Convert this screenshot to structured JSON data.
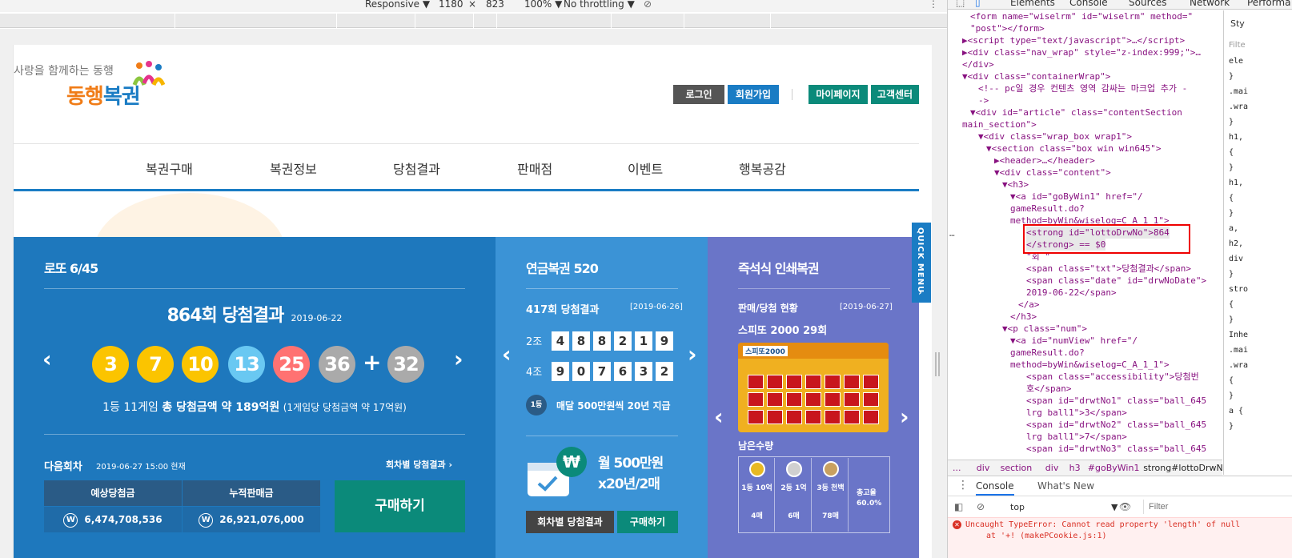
{
  "device_toolbar": {
    "mode": "Responsive ▼",
    "width": "1180",
    "times": "×",
    "height": "823",
    "zoom": "100% ▼",
    "throttle": "No throttling ▼"
  },
  "header": {
    "brand_sub": "사랑을 함께하는 동행",
    "brand_main_a": "동행",
    "brand_main_b": "복권",
    "login": "로그인",
    "join": "회원가입",
    "mypage": "마이페이지",
    "support": "고객센터"
  },
  "gnb": [
    "복권구매",
    "복권정보",
    "당첨결과",
    "판매점",
    "이벤트",
    "행복공감"
  ],
  "lotto": {
    "title": "로또 6/45",
    "round_result": "864회 당첨결과",
    "date": "2019-06-22",
    "balls": [
      {
        "n": "3",
        "color": "#fbc400"
      },
      {
        "n": "7",
        "color": "#fbc400"
      },
      {
        "n": "10",
        "color": "#fbc400"
      },
      {
        "n": "13",
        "color": "#69c8f2"
      },
      {
        "n": "25",
        "color": "#ff7272"
      },
      {
        "n": "36",
        "color": "#aaaaaa"
      }
    ],
    "plus": "+",
    "bonus": {
      "n": "32",
      "color": "#aaaaaa"
    },
    "prize_line_a": "1등 11게임",
    "prize_line_b": "총 당첨금액 약 189억원",
    "prize_line_c": "(1게임당 당첨금액 약 17억원)",
    "next_label": "다음회차",
    "next_date": "2019-06-27 15:00 현재",
    "by_round": "회차별 당첨결과",
    "expected_label": "예상당첨금",
    "accum_label": "누적판매금",
    "expected_value": "6,474,708,536",
    "accum_value": "26,921,076,000",
    "won_symbol": "W",
    "buy": "구매하기"
  },
  "pension": {
    "title": "연금복권 520",
    "round_result": "417회 당첨결과",
    "date": "[2019-06-26]",
    "row1_label": "2조",
    "row1": [
      "4",
      "8",
      "8",
      "2",
      "1",
      "9"
    ],
    "row2_label": "4조",
    "row2": [
      "9",
      "0",
      "7",
      "6",
      "3",
      "2"
    ],
    "first_badge": "1등",
    "first_desc": "매달 500만원씩 20년 지급",
    "promo_won": "₩",
    "promo_a": "월 500만원",
    "promo_b": "x20년/2매",
    "btn_round": "회차별 당첨결과",
    "btn_buy": "구매하기"
  },
  "instant": {
    "title": "즉석식 인쇄복권",
    "status": "판매/당첨 현황",
    "date": "[2019-06-27]",
    "game": "스피또 2000 29회",
    "ticket_label": "스피또2000",
    "remain": "남은수량",
    "cols": [
      "1등 10억",
      "2등 1억",
      "3등 천백"
    ],
    "counts": [
      "4매",
      "6매",
      "78매"
    ],
    "rate_label": "총고율",
    "rate_value": "60.0%"
  },
  "quickmenu": "QUICK MENU",
  "devtools": {
    "tabs": [
      "Elements",
      "Console",
      "Sources",
      "Network",
      "Performa"
    ],
    "lines": [
      {
        "indent": 2,
        "html": "&lt;form name=\"wiselrm\" id=\"wiselrm\" method=\""
      },
      {
        "indent": 2,
        "html": "\"post\"&gt;&lt;/form&gt;"
      },
      {
        "indent": 1,
        "html": "▶&lt;script type=\"text/javascript\"&gt;…&lt;/script&gt;"
      },
      {
        "indent": 1,
        "html": "▶&lt;div class=\"nav_wrap\" style=\"z-index:999;\"&gt;…"
      },
      {
        "indent": 1,
        "html": "&lt;/div&gt;"
      },
      {
        "indent": 1,
        "html": "▼&lt;div class=\"containerWrap\"&gt;"
      },
      {
        "indent": 3,
        "html": "&lt;!-- pc일 경우 컨텐츠 영역 감싸는 마크업 추가 -"
      },
      {
        "indent": 3,
        "html": "-&gt;"
      },
      {
        "indent": 2,
        "html": "▼&lt;div id=\"article\" class=\"contentSection"
      },
      {
        "indent": 1,
        "html": "main_section\"&gt;"
      },
      {
        "indent": 3,
        "html": "▼&lt;div class=\"wrap_box wrap1\"&gt;"
      },
      {
        "indent": 4,
        "html": "▼&lt;section class=\"box win win645\"&gt;"
      },
      {
        "indent": 5,
        "html": "▶&lt;header&gt;…&lt;/header&gt;"
      },
      {
        "indent": 5,
        "html": "▼&lt;div class=\"content\"&gt;"
      },
      {
        "indent": 6,
        "html": "▼&lt;h3&gt;"
      },
      {
        "indent": 7,
        "html": "▼&lt;a id=\"goByWin1\" href=\"/"
      },
      {
        "indent": 7,
        "html": "gameResult.do?"
      },
      {
        "indent": 7,
        "html": "method=byWin&amp;wiselog=C_A_1_1\"&gt;"
      },
      {
        "indent": 9,
        "html": "&lt;strong id=\"lottoDrwNo\"&gt;864"
      },
      {
        "indent": 9,
        "html": "&lt;/strong&gt; == $0"
      },
      {
        "indent": 9,
        "html": "\"회 \""
      },
      {
        "indent": 9,
        "html": "&lt;span class=\"txt\"&gt;당첨결과&lt;/span&gt;"
      },
      {
        "indent": 9,
        "html": "&lt;span class=\"date\" id=\"drwNoDate\"&gt;"
      },
      {
        "indent": 9,
        "html": "2019-06-22&lt;/span&gt;"
      },
      {
        "indent": 8,
        "html": "&lt;/a&gt;"
      },
      {
        "indent": 7,
        "html": "&lt;/h3&gt;"
      },
      {
        "indent": 6,
        "html": "▼&lt;p class=\"num\"&gt;"
      },
      {
        "indent": 7,
        "html": "▼&lt;a id=\"numView\" href=\"/"
      },
      {
        "indent": 7,
        "html": "gameResult.do?"
      },
      {
        "indent": 7,
        "html": "method=byWin&amp;wiselog=C_A_1_1\"&gt;"
      },
      {
        "indent": 9,
        "html": "&lt;span class=\"accessibility\"&gt;당첨번"
      },
      {
        "indent": 9,
        "html": "호&lt;/span&gt;"
      },
      {
        "indent": 9,
        "html": "&lt;span id=\"drwtNo1\" class=\"ball_645"
      },
      {
        "indent": 9,
        "html": "lrg ball1\"&gt;3&lt;/span&gt;"
      },
      {
        "indent": 9,
        "html": "&lt;span id=\"drwtNo2\" class=\"ball_645"
      },
      {
        "indent": 9,
        "html": "lrg ball1\"&gt;7&lt;/span&gt;"
      },
      {
        "indent": 9,
        "html": "&lt;span id=\"drwtNo3\" class=\"ball_645"
      }
    ],
    "crumbs": [
      "...",
      "div",
      "section",
      "div",
      "h3",
      "#goByWin1",
      "strong#lottoDrwNo"
    ],
    "styles_tab": "Sty",
    "styles_filter": "Filte",
    "styles_lines": [
      "ele",
      "}",
      ".mai",
      ".wra",
      "}",
      "h1,",
      "{",
      "}",
      "h1,",
      "{",
      "}",
      "a, ",
      "h2,",
      "div",
      "}",
      "stro",
      "{",
      "}",
      "Inhe",
      ".mai",
      ".wra",
      "{",
      "}",
      "a {",
      "}"
    ],
    "drawer_tabs": [
      "Console",
      "What's New"
    ],
    "context": "top",
    "filter_placeholder": "Filter",
    "error_line1": "Uncaught TypeError: Cannot read property 'length' of null",
    "error_line2": "at '+! (makePCookie.js:1)"
  }
}
